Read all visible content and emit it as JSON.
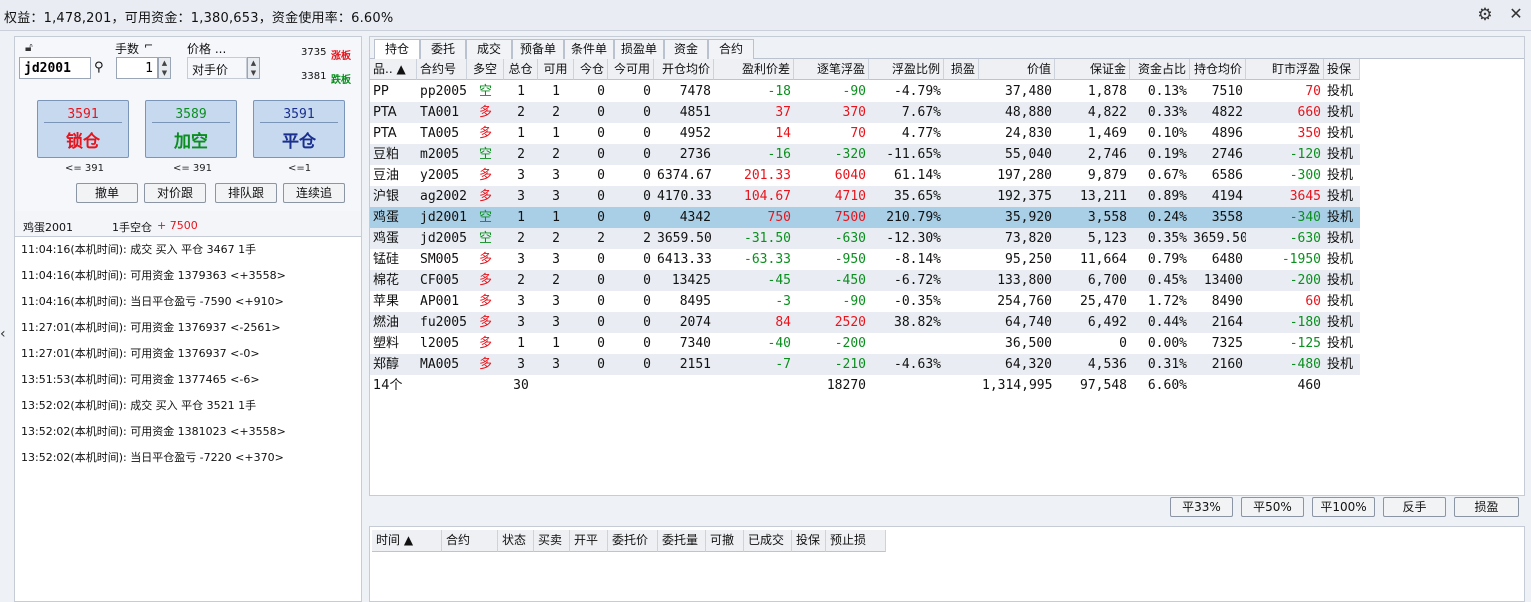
{
  "header": {
    "summary": "权益：1,478,201，可用资金：1,380,653，资金使用率：6.60%",
    "settings_icon": "gear-icon",
    "close_icon": "close-icon"
  },
  "order_form": {
    "symbol_value": "jd2001",
    "lots_label": "手数",
    "lots_value": "1",
    "price_label": "价格 ...",
    "price_value": "对手价",
    "limit_up_value": "3735",
    "limit_up_label": "涨板",
    "limit_down_value": "3381",
    "limit_down_label": "跌板",
    "buttons": [
      {
        "price": "3591",
        "label": "锁仓",
        "sub": "<= 391",
        "price_color": "#e8141c",
        "label_color": "#e8141c"
      },
      {
        "price": "3589",
        "label": "加空",
        "sub": "<= 391",
        "price_color": "#0a8f1e",
        "label_color": "#0a8f1e"
      },
      {
        "price": "3591",
        "label": "平仓",
        "sub": "<=1",
        "price_color": "#1a2f8f",
        "label_color": "#1a2f8f"
      }
    ],
    "small_buttons": [
      "撤单",
      "对价跟",
      "排队跟",
      "连续追"
    ]
  },
  "position_line": {
    "name": "鸡蛋2001",
    "desc": "1手空仓",
    "pnl": "+ 7500"
  },
  "log": [
    "11:04:16(本机时间): 成交  买入  平仓  3467  1手",
    "11:04:16(本机时间): 可用资金 1379363  <+3558>",
    "11:04:16(本机时间): 当日平仓盈亏 -7590  <+910>",
    "11:27:01(本机时间): 可用资金 1376937  <-2561>",
    "11:27:01(本机时间): 可用资金 1376937  <-0>",
    "13:51:53(本机时间): 可用资金 1377465  <-6>",
    "13:52:02(本机时间): 成交  买入  平仓  3521  1手",
    "13:52:02(本机时间): 可用资金 1381023  <+3558>",
    "13:52:02(本机时间): 当日平仓盈亏 -7220  <+370>"
  ],
  "tabs": [
    "持仓",
    "委托",
    "成交",
    "预备单",
    "条件单",
    "损盈单",
    "资金",
    "合约"
  ],
  "table": {
    "headers": [
      "品.. ▲",
      "合约号",
      "多空",
      "总仓",
      "可用",
      "今仓",
      "今可用",
      "开仓均价",
      "盈利价差",
      "逐笔浮盈",
      "浮盈比例",
      "损盈",
      "价值",
      "保证金",
      "资金占比",
      "持仓均价",
      "盯市浮盈",
      "投保"
    ],
    "rows": [
      [
        "PP",
        "pp2005",
        "空",
        "1",
        "1",
        "0",
        "0",
        "7478",
        "-18",
        "-90",
        "-4.79%",
        "",
        "37,480",
        "1,878",
        "0.13%",
        "7510",
        "70",
        "投机"
      ],
      [
        "PTA",
        "TA001",
        "多",
        "2",
        "2",
        "0",
        "0",
        "4851",
        "37",
        "370",
        "7.67%",
        "",
        "48,880",
        "4,822",
        "0.33%",
        "4822",
        "660",
        "投机"
      ],
      [
        "PTA",
        "TA005",
        "多",
        "1",
        "1",
        "0",
        "0",
        "4952",
        "14",
        "70",
        "4.77%",
        "",
        "24,830",
        "1,469",
        "0.10%",
        "4896",
        "350",
        "投机"
      ],
      [
        "豆粕",
        "m2005",
        "空",
        "2",
        "2",
        "0",
        "0",
        "2736",
        "-16",
        "-320",
        "-11.65%",
        "",
        "55,040",
        "2,746",
        "0.19%",
        "2746",
        "-120",
        "投机"
      ],
      [
        "豆油",
        "y2005",
        "多",
        "3",
        "3",
        "0",
        "0",
        "6374.67",
        "201.33",
        "6040",
        "61.14%",
        "",
        "197,280",
        "9,879",
        "0.67%",
        "6586",
        "-300",
        "投机"
      ],
      [
        "沪银",
        "ag2002",
        "多",
        "3",
        "3",
        "0",
        "0",
        "4170.33",
        "104.67",
        "4710",
        "35.65%",
        "",
        "192,375",
        "13,211",
        "0.89%",
        "4194",
        "3645",
        "投机"
      ],
      [
        "鸡蛋",
        "jd2001",
        "空",
        "1",
        "1",
        "0",
        "0",
        "4342",
        "750",
        "7500",
        "210.79%",
        "",
        "35,920",
        "3,558",
        "0.24%",
        "3558",
        "-340",
        "投机"
      ],
      [
        "鸡蛋",
        "jd2005",
        "空",
        "2",
        "2",
        "2",
        "2",
        "3659.50",
        "-31.50",
        "-630",
        "-12.30%",
        "",
        "73,820",
        "5,123",
        "0.35%",
        "3659.50",
        "-630",
        "投机"
      ],
      [
        "锰硅",
        "SM005",
        "多",
        "3",
        "3",
        "0",
        "0",
        "6413.33",
        "-63.33",
        "-950",
        "-8.14%",
        "",
        "95,250",
        "11,664",
        "0.79%",
        "6480",
        "-1950",
        "投机"
      ],
      [
        "棉花",
        "CF005",
        "多",
        "2",
        "2",
        "0",
        "0",
        "13425",
        "-45",
        "-450",
        "-6.72%",
        "",
        "133,800",
        "6,700",
        "0.45%",
        "13400",
        "-200",
        "投机"
      ],
      [
        "苹果",
        "AP001",
        "多",
        "3",
        "3",
        "0",
        "0",
        "8495",
        "-3",
        "-90",
        "-0.35%",
        "",
        "254,760",
        "25,470",
        "1.72%",
        "8490",
        "60",
        "投机"
      ],
      [
        "燃油",
        "fu2005",
        "多",
        "3",
        "3",
        "0",
        "0",
        "2074",
        "84",
        "2520",
        "38.82%",
        "",
        "64,740",
        "6,492",
        "0.44%",
        "2164",
        "-180",
        "投机"
      ],
      [
        "塑料",
        "l2005",
        "多",
        "1",
        "1",
        "0",
        "0",
        "7340",
        "-40",
        "-200",
        "",
        "",
        "36,500",
        "0",
        "0.00%",
        "7325",
        "-125",
        "投机"
      ],
      [
        "郑醇",
        "MA005",
        "多",
        "3",
        "3",
        "0",
        "0",
        "2151",
        "-7",
        "-210",
        "-4.63%",
        "",
        "64,320",
        "4,536",
        "0.31%",
        "2160",
        "-480",
        "投机"
      ]
    ],
    "total_row": [
      "14个",
      "",
      "",
      "30",
      "",
      "",
      "",
      "",
      "",
      "18270",
      "",
      "",
      "1,314,995",
      "97,548",
      "6.60%",
      "",
      "460",
      ""
    ]
  },
  "close_buttons": [
    "平33%",
    "平50%",
    "平100%",
    "反手",
    "损盈"
  ],
  "order_table_headers": [
    "时间 ▲",
    "合约",
    "状态",
    "买卖",
    "开平",
    "委托价",
    "委托量",
    "可撤",
    "已成交",
    "投保",
    "预止损"
  ],
  "colors": {
    "profit": "#e8141c",
    "loss": "#0a8f1e",
    "selected_row": "#a9cfe6"
  }
}
